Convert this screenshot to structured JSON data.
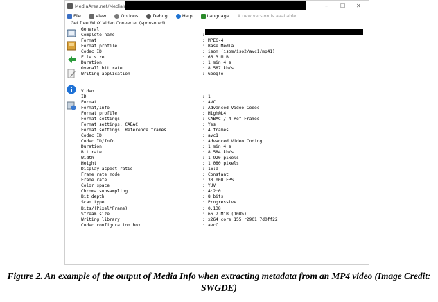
{
  "window": {
    "title": "MediaArea.net/MediaInfo",
    "controls": [
      "–",
      "☐",
      "✕"
    ]
  },
  "menu": {
    "items": [
      {
        "label": "File",
        "icon": "file-icon",
        "color": "#3b6fc4"
      },
      {
        "label": "View",
        "icon": "view-icon",
        "color": "#6a6a6a"
      },
      {
        "label": "Options",
        "icon": "options-icon",
        "color": "#7a7a7a"
      },
      {
        "label": "Debug",
        "icon": "debug-icon",
        "color": "#555555"
      },
      {
        "label": "Help",
        "icon": "help-icon",
        "color": "#1e73d2"
      },
      {
        "label": "Language",
        "icon": "language-icon",
        "color": "#2a8a2a"
      }
    ],
    "note": "A new version is available"
  },
  "ad": {
    "text": "Get free WinX Video Converter (sponsored)"
  },
  "general": {
    "header": "General",
    "fields": [
      {
        "key": "Complete name",
        "value": ""
      },
      {
        "key": "Format",
        "value": "MPEG-4"
      },
      {
        "key": "Format profile",
        "value": "Base Media"
      },
      {
        "key": "Codec ID",
        "value": "isom (isom/iso2/avc1/mp41)"
      },
      {
        "key": "File size",
        "value": "66.3 MiB"
      },
      {
        "key": "Duration",
        "value": "1 min 4 s"
      },
      {
        "key": "Overall bit rate",
        "value": "8 587 kb/s"
      },
      {
        "key": "Writing application",
        "value": "Google"
      }
    ]
  },
  "video": {
    "header": "Video",
    "fields": [
      {
        "key": "ID",
        "value": "1"
      },
      {
        "key": "Format",
        "value": "AVC"
      },
      {
        "key": "Format/Info",
        "value": "Advanced Video Codec"
      },
      {
        "key": "Format profile",
        "value": "High@L4"
      },
      {
        "key": "Format settings",
        "value": "CABAC / 4 Ref Frames"
      },
      {
        "key": "Format settings, CABAC",
        "value": "Yes"
      },
      {
        "key": "Format settings, Reference frames",
        "value": "4 frames"
      },
      {
        "key": "Codec ID",
        "value": "avc1"
      },
      {
        "key": "Codec ID/Info",
        "value": "Advanced Video Coding"
      },
      {
        "key": "Duration",
        "value": "1 min 4 s"
      },
      {
        "key": "Bit rate",
        "value": "8 584 kb/s"
      },
      {
        "key": "Width",
        "value": "1 920 pixels"
      },
      {
        "key": "Height",
        "value": "1 080 pixels"
      },
      {
        "key": "Display aspect ratio",
        "value": "16:9"
      },
      {
        "key": "Frame rate mode",
        "value": "Constant"
      },
      {
        "key": "Frame rate",
        "value": "30.000 FPS"
      },
      {
        "key": "Color space",
        "value": "YUV"
      },
      {
        "key": "Chroma subsampling",
        "value": "4:2:0"
      },
      {
        "key": "Bit depth",
        "value": "8 bits"
      },
      {
        "key": "Scan type",
        "value": "Progressive"
      },
      {
        "key": "Bits/(Pixel*Frame)",
        "value": "0.138"
      },
      {
        "key": "Stream size",
        "value": "66.2 MiB (100%)"
      },
      {
        "key": "Writing library",
        "value": "x264 core 155 r2901 7d0ff22"
      },
      {
        "key": "Codec configuration box",
        "value": "avcC"
      }
    ]
  },
  "caption": "Figure 2. An example of the output of Media Info when extracting metadata from an MP4 video (Image Credit: SWGDE)"
}
